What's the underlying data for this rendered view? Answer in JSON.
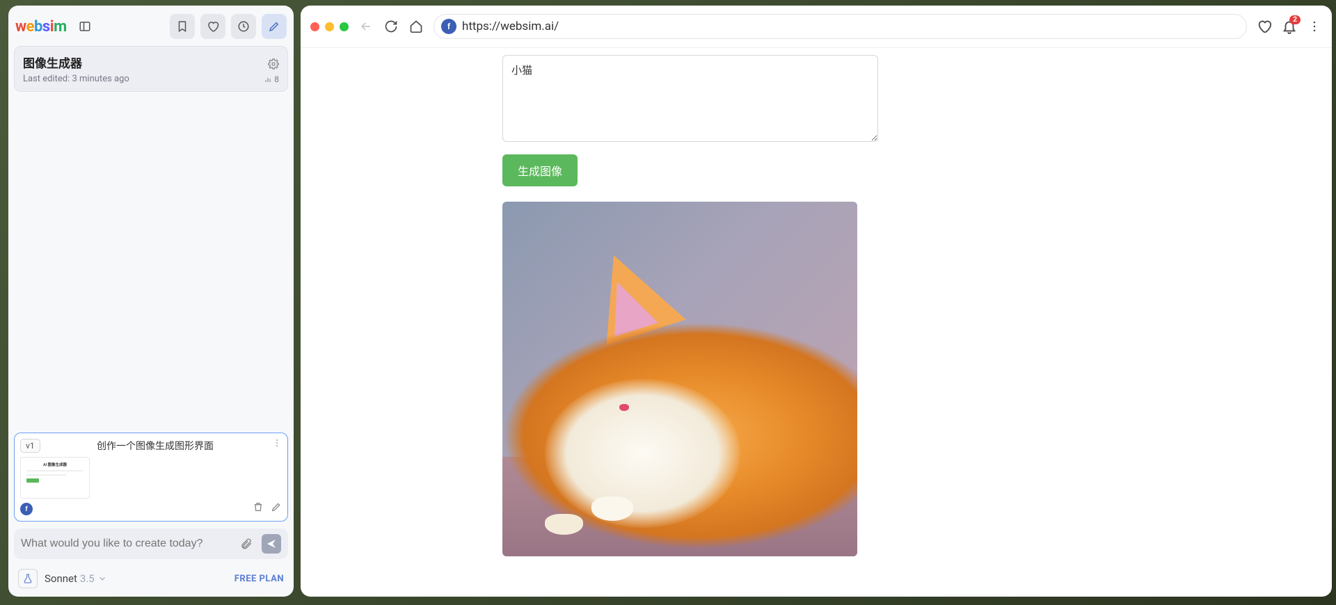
{
  "logo": {
    "letters": [
      "w",
      "e",
      "b",
      "s",
      "i",
      "m"
    ]
  },
  "project": {
    "title": "图像生成器",
    "last_edited": "Last edited: 3 minutes ago",
    "views": "8"
  },
  "version": {
    "badge": "v1",
    "description": "创作一个图像生成图形界面",
    "avatar_letter": "f",
    "thumb_title": "AI 图像生成器"
  },
  "prompt": {
    "placeholder": "What would you like to create today?"
  },
  "footer": {
    "model_name": "Sonnet",
    "model_version": "3.5",
    "plan": "FREE PLAN"
  },
  "browser": {
    "url": "https://websim.ai/",
    "fav_letter": "f",
    "notif_count": "2"
  },
  "generator": {
    "prompt_value": "小猫",
    "button_label": "生成图像"
  }
}
